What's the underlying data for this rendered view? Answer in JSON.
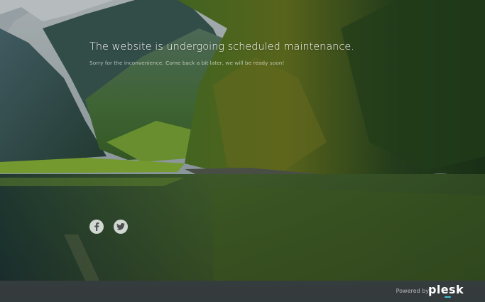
{
  "page": {
    "headline": "The website is undergoing scheduled maintenance.",
    "subline": "Sorry for the inconvenience. Come back a bit later, we will be ready soon!"
  },
  "social": [
    {
      "name": "facebook-icon",
      "glyph": "f"
    },
    {
      "name": "twitter-icon",
      "glyph": "bird"
    }
  ],
  "footer": {
    "powered_by": "Powered by",
    "brand": "plesk",
    "accent_color": "#3fc3d8"
  }
}
